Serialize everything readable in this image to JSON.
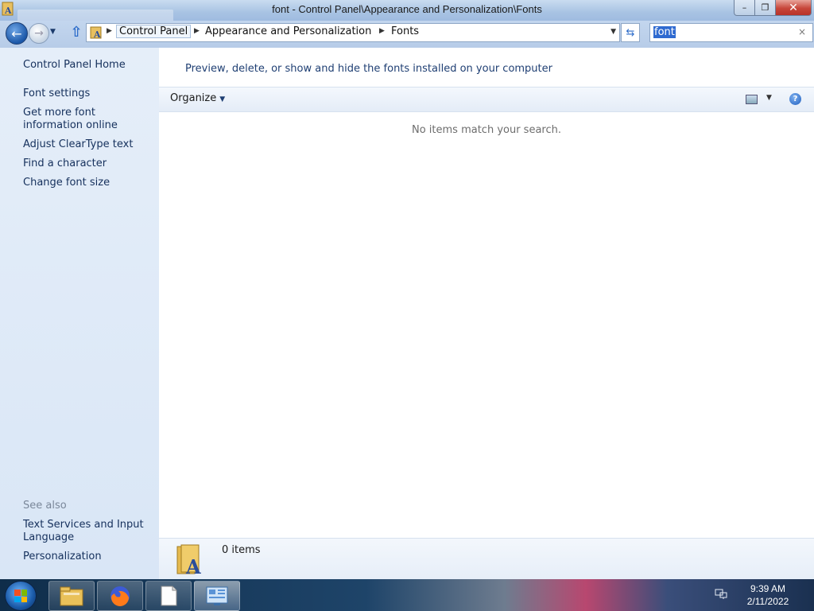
{
  "window": {
    "title": "font - Control Panel\\Appearance and Personalization\\Fonts",
    "controls": {
      "minimize": "–",
      "maximize": "❐",
      "close": "✕"
    }
  },
  "address": {
    "back_icon": "arrow-left-icon",
    "forward_icon": "arrow-right-icon",
    "crumbs": [
      "Control Panel",
      "Appearance and Personalization",
      "Fonts"
    ]
  },
  "search": {
    "value": "font",
    "clear_label": "×"
  },
  "left_pane": {
    "links": [
      "Control Panel Home",
      "Font settings",
      "Get more font information online",
      "Adjust ClearType text",
      "Find a character",
      "Change font size"
    ],
    "see_also_heading": "See also",
    "see_also": [
      "Text Services and Input Language",
      "Personalization"
    ]
  },
  "content": {
    "header": "Preview, delete, or show and hide the fonts installed on your computer",
    "toolbar": {
      "organize_label": "Organize",
      "help_label": "?"
    },
    "empty_message": "No items match your search.",
    "details": {
      "count": "0 items"
    }
  },
  "taskbar": {
    "pinned": [
      "file-explorer-icon",
      "firefox-icon",
      "notepad-icon",
      "control-panel-icon"
    ],
    "clock": {
      "time": "9:39 AM",
      "date": "2/11/2022"
    }
  },
  "colors": {
    "link": "#15305c",
    "header_text": "#1f3f73",
    "left_pane_bg": "#dbe7f5",
    "search_highlight": "#2f6ad0"
  }
}
